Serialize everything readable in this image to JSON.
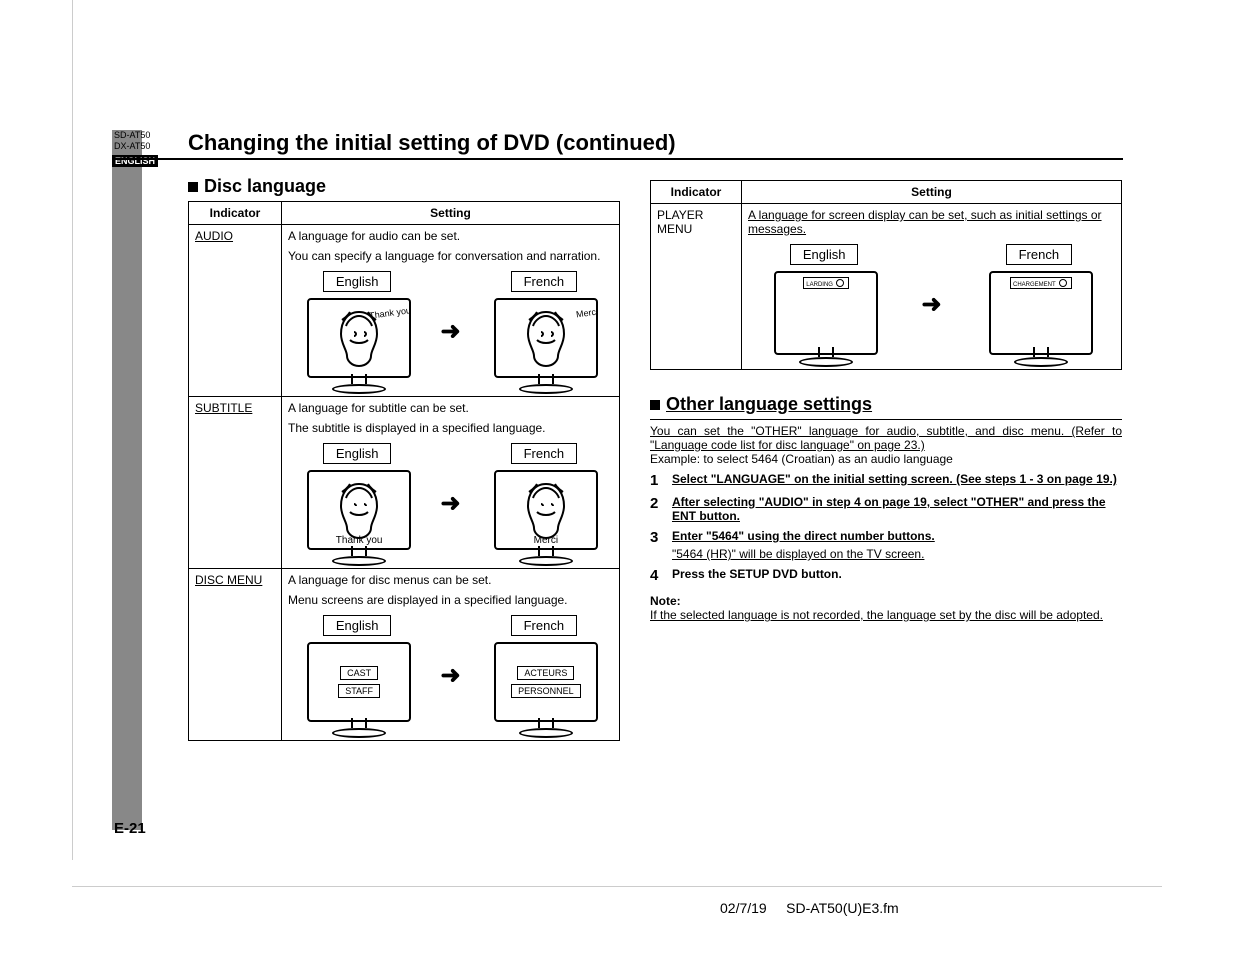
{
  "models": [
    "SD-AT50",
    "DX-AT50"
  ],
  "lang_tag": "ENGLISH",
  "title": "Changing the initial setting of DVD (continued)",
  "disc_lang": {
    "heading": "Disc language",
    "headers": {
      "indicator": "Indicator",
      "setting": "Setting"
    },
    "rows": {
      "audio": {
        "indicator": "AUDIO",
        "line1": "A language for audio can be set.",
        "line2": "You can specify a language for conversation and narration.",
        "eng": {
          "label": "English",
          "bubble": "Thank you"
        },
        "fr": {
          "label": "French",
          "bubble": "Merci"
        }
      },
      "subtitle": {
        "indicator": "SUBTITLE",
        "line1": "A language for subtitle can be set.",
        "line2": "The subtitle is displayed in a specified language.",
        "eng": {
          "label": "English",
          "sub": "Thank you"
        },
        "fr": {
          "label": "French",
          "sub": "Merci"
        }
      },
      "discmenu": {
        "indicator": "DISC MENU",
        "line1": "A language for disc menus can be set.",
        "line2": "Menu screens are displayed in a specified language.",
        "eng": {
          "label": "English",
          "btn1": "CAST",
          "btn2": "STAFF"
        },
        "fr": {
          "label": "French",
          "btn1": "ACTEURS",
          "btn2": "PERSONNEL"
        }
      }
    }
  },
  "player_menu": {
    "headers": {
      "indicator": "Indicator",
      "setting": "Setting"
    },
    "indicator": "PLAYER MENU",
    "setting": "A language for screen display can be set, such as initial settings or messages.",
    "eng": {
      "label": "English",
      "banner": "LARDING"
    },
    "fr": {
      "label": "French",
      "banner": "CHARGEMENT"
    }
  },
  "other": {
    "heading": "Other language settings",
    "intro": "You can set the \"OTHER\" language for audio, subtitle, and disc menu. (Refer to \"Language code list for disc language\" on page 23.)",
    "example": "Example: to select 5464 (Croatian) as an audio language",
    "steps": {
      "s1": "Select \"LANGUAGE\" on the initial setting screen. (See steps 1 - 3 on page 19.)",
      "s2": "After selecting \"AUDIO\" in step 4 on page 19, select \"OTHER\" and press the ENT button.",
      "s3": "Enter \"5464\" using the direct number buttons.",
      "s3b": "\"5464 (HR)\" will be displayed on the TV screen.",
      "s4": "Press the SETUP DVD button."
    },
    "note_label": "Note:",
    "note": "If the selected language is not recorded, the language set by the disc will be adopted."
  },
  "page_num": "E-21",
  "footer": {
    "date": "02/7/19",
    "file": "SD-AT50(U)E3.fm"
  }
}
